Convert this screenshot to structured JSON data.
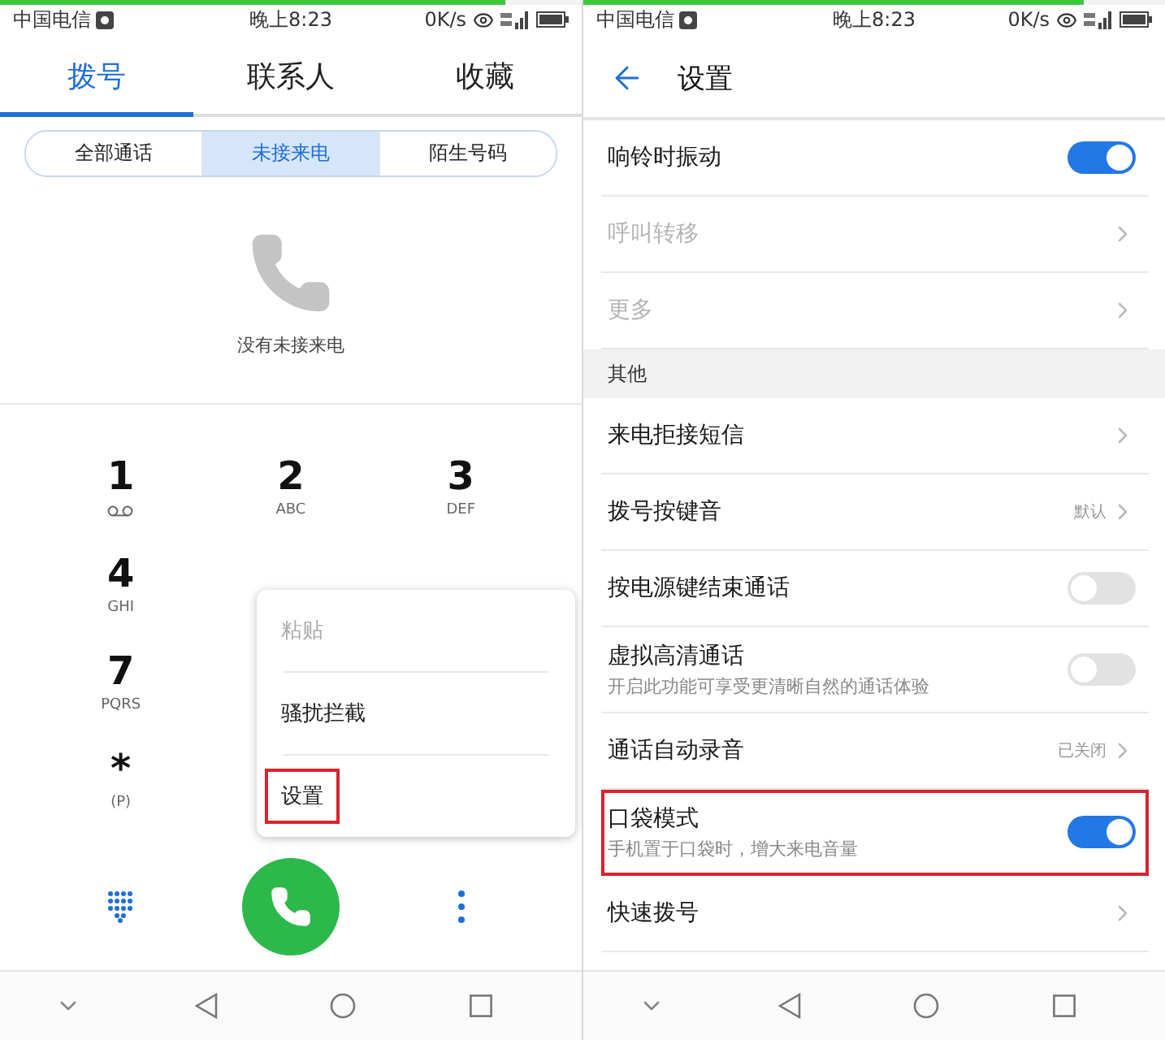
{
  "left": {
    "status_bar": {
      "carrier": "中国电信",
      "time": "晚上8:23",
      "speed": "0K/s"
    },
    "progress": {
      "level": 0.87
    },
    "tabs": [
      {
        "label": "拨号",
        "selected": true
      },
      {
        "label": "联系人",
        "selected": false
      },
      {
        "label": "收藏",
        "selected": false
      }
    ],
    "filters": [
      {
        "label": "全部通话",
        "selected": false
      },
      {
        "label": "未接来电",
        "selected": true
      },
      {
        "label": "陌生号码",
        "selected": false
      }
    ],
    "empty_state": {
      "text": "没有未接来电"
    },
    "keypad": [
      [
        {
          "digit": "1",
          "kind": "voicemail"
        },
        {
          "digit": "2",
          "kind": "letters",
          "letters": "ABC"
        },
        {
          "digit": "3",
          "kind": "letters",
          "letters": "DEF"
        }
      ],
      [
        {
          "digit": "4",
          "kind": "letters",
          "letters": "GHI"
        }
      ],
      [
        {
          "digit": "7",
          "kind": "letters",
          "letters": "PQRS"
        }
      ],
      [
        {
          "digit": "*",
          "kind": "letters",
          "letters": "(P)"
        }
      ]
    ],
    "menu": [
      {
        "label": "粘贴",
        "disabled": true,
        "highlighted": false
      },
      {
        "label": "骚扰拦截",
        "disabled": false,
        "highlighted": false
      },
      {
        "label": "设置",
        "disabled": false,
        "highlighted": true
      }
    ]
  },
  "right": {
    "status_bar": {
      "carrier": "中国电信",
      "time": "晚上8:23",
      "speed": "0K/s"
    },
    "progress": {
      "level": 0.86
    },
    "title": "设置",
    "settings": [
      {
        "kind": "toggle",
        "label": "响铃时振动",
        "on": true,
        "disabled": false,
        "highlighted": false
      },
      {
        "kind": "link",
        "label": "呼叫转移",
        "disabled": true,
        "highlighted": false
      },
      {
        "kind": "link",
        "label": "更多",
        "disabled": true,
        "highlighted": false
      },
      {
        "kind": "section",
        "label": "其他"
      },
      {
        "kind": "link",
        "label": "来电拒接短信",
        "disabled": false,
        "highlighted": false
      },
      {
        "kind": "link",
        "label": "拨号按键音",
        "value": "默认",
        "disabled": false,
        "highlighted": false
      },
      {
        "kind": "toggle",
        "label": "按电源键结束通话",
        "on": false,
        "disabled": false,
        "highlighted": false
      },
      {
        "kind": "toggle",
        "label": "虚拟高清通话",
        "subtitle": "开启此功能可享受更清晰自然的通话体验",
        "on": false,
        "disabled": false,
        "highlighted": false
      },
      {
        "kind": "link",
        "label": "通话自动录音",
        "value": "已关闭",
        "disabled": false,
        "highlighted": false
      },
      {
        "kind": "toggle",
        "label": "口袋模式",
        "subtitle": "手机置于口袋时，增大来电音量",
        "on": true,
        "disabled": false,
        "highlighted": true
      },
      {
        "kind": "link",
        "label": "快速拨号",
        "disabled": false,
        "highlighted": false
      }
    ]
  }
}
